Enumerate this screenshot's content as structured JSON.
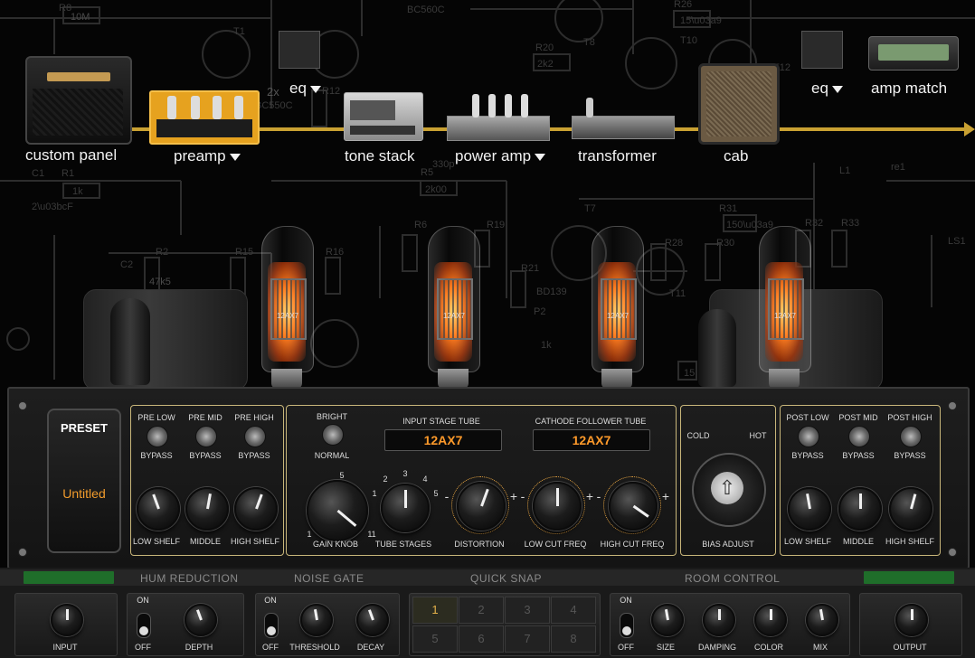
{
  "chain": {
    "custom_panel": "custom panel",
    "preamp": "preamp",
    "eq1": "eq",
    "tone_stack": "tone stack",
    "power_amp": "power amp",
    "transformer": "transformer",
    "cab": "cab",
    "eq2": "eq",
    "amp_match": "amp match"
  },
  "schematic": {
    "labels": [
      "R8",
      "10M",
      "BC560C",
      "T1",
      "R12",
      "2x",
      "BC550C",
      "T8",
      "R20",
      "2k2",
      "R26",
      "15Ω",
      "T10",
      "T12",
      "C1",
      "R1",
      "1k",
      "2μF",
      "R5",
      "2k00",
      "330p",
      "R6",
      "R19",
      "T7",
      "R31",
      "150Ω",
      "R32",
      "R33",
      "re1",
      "L1",
      "LS1",
      "R2",
      "47k5",
      "C2",
      "R15",
      "R16",
      "R21",
      "BD139",
      "P2",
      "1k",
      "R28",
      "R30",
      "15",
      "T11"
    ]
  },
  "tubes": {
    "label": "12AX7"
  },
  "preset": {
    "title": "PRESET",
    "name": "Untitled"
  },
  "pre_eq": {
    "toggles": [
      {
        "top": "PRE LOW",
        "bottom": "BYPASS"
      },
      {
        "top": "PRE MID",
        "bottom": "BYPASS"
      },
      {
        "top": "PRE HIGH",
        "bottom": "BYPASS"
      }
    ],
    "knobs": [
      "LOW SHELF",
      "MIDDLE",
      "HIGH SHELF"
    ]
  },
  "preamp_section": {
    "bright_top": "BRIGHT",
    "bright_bottom": "NORMAL",
    "input_tube_label": "INPUT STAGE TUBE",
    "input_tube_value": "12AX7",
    "cathode_tube_label": "CATHODE FOLLOWER TUBE",
    "cathode_tube_value": "12AX7",
    "gain_knob": "GAIN KNOB",
    "gain_scale": [
      "1",
      "5",
      "11"
    ],
    "tube_stages": "TUBE STAGES",
    "stage_marks": [
      "1",
      "2",
      "3",
      "4",
      "5"
    ],
    "distortion": "DISTORTION",
    "low_cut": "LOW CUT FREQ",
    "high_cut": "HIGH CUT FREQ",
    "minus": "-",
    "plus": "+"
  },
  "bias": {
    "cold": "COLD",
    "hot": "HOT",
    "label": "BIAS ADJUST"
  },
  "post_eq": {
    "toggles": [
      {
        "top": "POST LOW",
        "bottom": "BYPASS"
      },
      {
        "top": "POST MID",
        "bottom": "BYPASS"
      },
      {
        "top": "POST HIGH",
        "bottom": "BYPASS"
      }
    ],
    "knobs": [
      "LOW SHELF",
      "MIDDLE",
      "HIGH SHELF"
    ]
  },
  "bottom": {
    "hum_reduction": "HUM REDUCTION",
    "noise_gate": "NOISE GATE",
    "quick_snap": "QUICK SNAP",
    "room_control": "ROOM CONTROL",
    "input": "INPUT",
    "on": "ON",
    "off": "OFF",
    "depth": "DEPTH",
    "threshold": "THRESHOLD",
    "decay": "DECAY",
    "snaps": [
      "1",
      "2",
      "3",
      "4",
      "5",
      "6",
      "7",
      "8"
    ],
    "active_snap": 1,
    "size": "SIZE",
    "damping": "DAMPING",
    "color": "COLOR",
    "mix": "MIX",
    "output": "OUTPUT"
  },
  "colors": {
    "accent": "#c9a132",
    "display": "#ff9a2a",
    "led": "#1f6e2a"
  }
}
